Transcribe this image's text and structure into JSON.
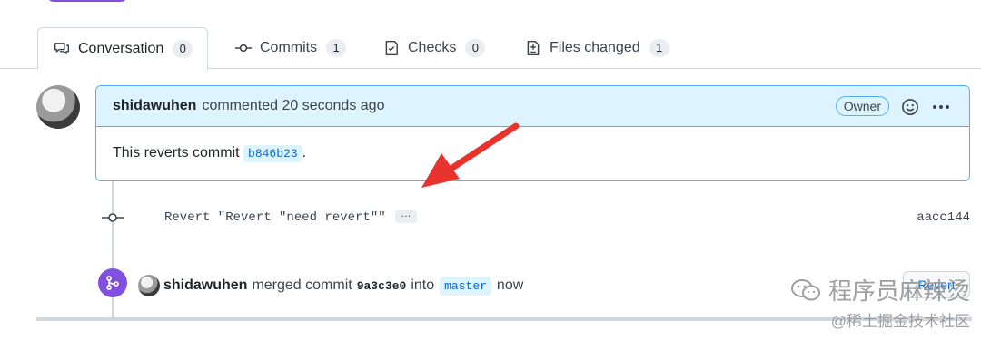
{
  "tabs": [
    {
      "label": "Conversation",
      "count": "0",
      "icon": "comment-discussion-icon"
    },
    {
      "label": "Commits",
      "count": "1",
      "icon": "git-commit-icon"
    },
    {
      "label": "Checks",
      "count": "0",
      "icon": "checklist-icon"
    },
    {
      "label": "Files changed",
      "count": "1",
      "icon": "file-diff-icon"
    }
  ],
  "comment": {
    "author": "shidawuhen",
    "meta": "commented 20 seconds ago",
    "badge": "Owner",
    "body_text": "This reverts commit",
    "body_sha": "b846b23",
    "body_end": "."
  },
  "commit": {
    "message": "Revert \"Revert \"need revert\"\"",
    "ellipsis": "…",
    "sha": "aacc144"
  },
  "merge": {
    "author": "shidawuhen",
    "text1": "merged commit",
    "commit_sha": "9a3c3e0",
    "text2": "into",
    "branch": "master",
    "text3": "now",
    "revert_label": "Revert"
  },
  "watermark": {
    "line1": "程序员麻辣烫",
    "line2": "@稀土掘金技术社区"
  },
  "colors": {
    "accent": "#0969da",
    "merged": "#8250df",
    "comment_header": "#ddf4ff",
    "annotation_arrow": "#e8322c"
  }
}
